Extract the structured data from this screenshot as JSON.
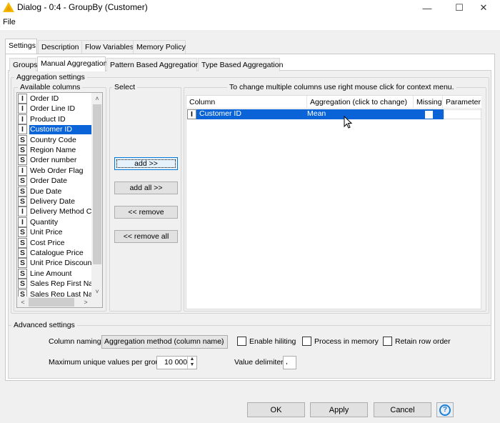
{
  "window": {
    "title": "Dialog - 0:4 - GroupBy (Customer)",
    "icon": "warning-triangle-icon",
    "controls": {
      "minimize": "—",
      "maximize": "☐",
      "close": "✕"
    }
  },
  "menubar": {
    "items": [
      "File"
    ]
  },
  "main_tabs": [
    {
      "label": "Settings",
      "active": true
    },
    {
      "label": "Description",
      "active": false
    },
    {
      "label": "Flow Variables",
      "active": false
    },
    {
      "label": "Memory Policy",
      "active": false
    }
  ],
  "sub_tabs": [
    {
      "label": "Groups",
      "active": false
    },
    {
      "label": "Manual Aggregation",
      "active": true
    },
    {
      "label": "Pattern Based Aggregation",
      "active": false
    },
    {
      "label": "Type Based Aggregation",
      "active": false
    }
  ],
  "aggregation_settings": {
    "title": "Aggregation settings",
    "available_columns": {
      "title": "Available columns",
      "items": [
        {
          "type": "I",
          "label": "Order ID",
          "selected": false
        },
        {
          "type": "I",
          "label": "Order Line ID",
          "selected": false
        },
        {
          "type": "I",
          "label": "Product ID",
          "selected": false
        },
        {
          "type": "I",
          "label": "Customer ID",
          "selected": true
        },
        {
          "type": "S",
          "label": "Country Code",
          "selected": false
        },
        {
          "type": "S",
          "label": "Region Name",
          "selected": false
        },
        {
          "type": "S",
          "label": "Order number",
          "selected": false
        },
        {
          "type": "I",
          "label": "Web Order Flag",
          "selected": false
        },
        {
          "type": "S",
          "label": "Order Date",
          "selected": false
        },
        {
          "type": "S",
          "label": "Due Date",
          "selected": false
        },
        {
          "type": "S",
          "label": "Delivery Date",
          "selected": false
        },
        {
          "type": "I",
          "label": "Delivery Method Co",
          "selected": false
        },
        {
          "type": "I",
          "label": "Quantity",
          "selected": false
        },
        {
          "type": "S",
          "label": "Unit Price",
          "selected": false
        },
        {
          "type": "S",
          "label": "Cost Price",
          "selected": false
        },
        {
          "type": "S",
          "label": "Catalogue Price",
          "selected": false
        },
        {
          "type": "S",
          "label": "Unit Price Discount",
          "selected": false
        },
        {
          "type": "S",
          "label": "Line Amount",
          "selected": false
        },
        {
          "type": "S",
          "label": "Sales Rep First Nam",
          "selected": false
        },
        {
          "type": "S",
          "label": "Sales Rep Last Nam",
          "selected": false
        }
      ],
      "scroll_up": "˄",
      "scroll_down": "˅",
      "scroll_left": "<",
      "scroll_right": ">"
    },
    "select": {
      "title": "Select",
      "add": "add >>",
      "add_all": "add all >>",
      "remove": "<< remove",
      "remove_all": "<< remove all"
    },
    "table": {
      "hint": "To change multiple columns use right mouse click for context menu.",
      "headers": [
        "Column",
        "Aggregation (click to change)",
        "Missing",
        "Parameter"
      ],
      "rows": [
        {
          "type": "I",
          "column": "Customer ID",
          "aggregation": "Mean",
          "missing": false,
          "parameter": ""
        }
      ]
    }
  },
  "advanced_settings": {
    "title": "Advanced settings",
    "column_naming_label": "Column naming:",
    "column_naming_value": "Aggregation method (column name)",
    "enable_hiliting": {
      "label": "Enable hiliting",
      "checked": false
    },
    "process_in_memory": {
      "label": "Process in memory",
      "checked": false
    },
    "retain_row_order": {
      "label": "Retain row order",
      "checked": false
    },
    "max_unique_label": "Maximum unique values per group",
    "max_unique_value": "10 000",
    "value_delimiter_label": "Value delimiter",
    "value_delimiter_value": ","
  },
  "footer": {
    "ok": "OK",
    "apply": "Apply",
    "cancel": "Cancel",
    "help_icon": "?"
  },
  "colors": {
    "selection": "#0a64d8",
    "warning_icon": "#f5b800",
    "help_icon": "#1a7fd4"
  }
}
